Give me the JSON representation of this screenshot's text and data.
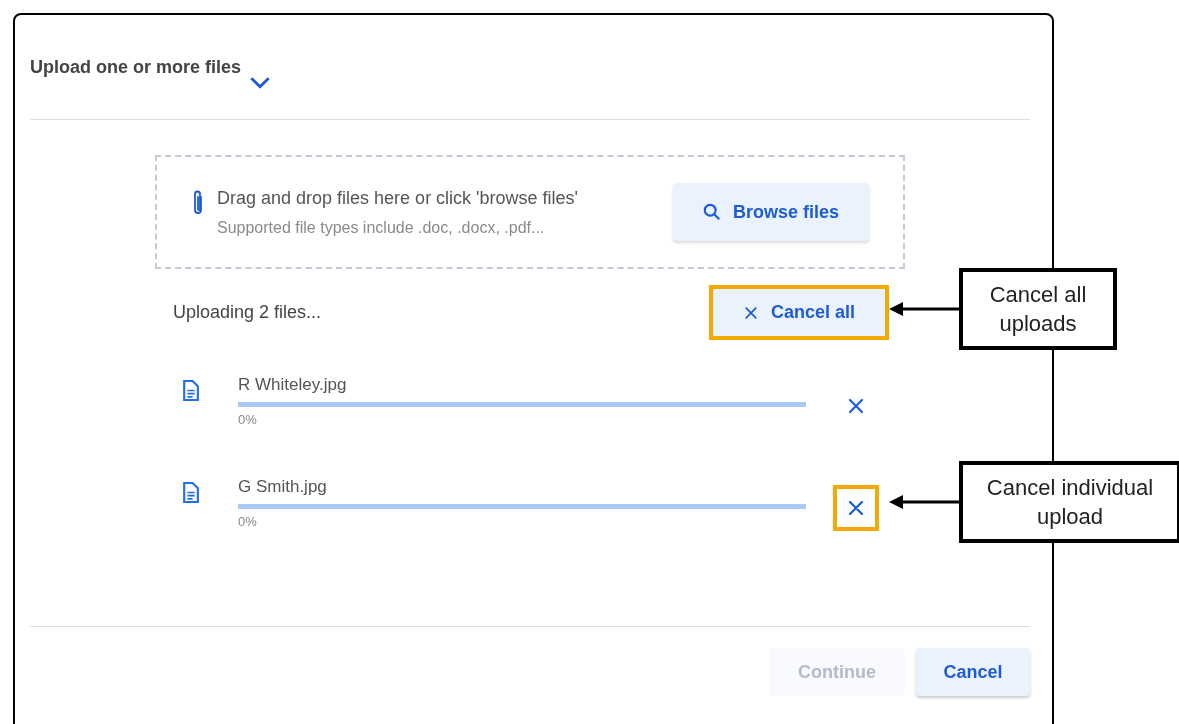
{
  "dialog": {
    "title": "Upload one or more files",
    "expanded": true
  },
  "dropzone": {
    "prompt": "Drag and drop files here or click 'browse files'",
    "hint": "Supported file types include .doc, .docx, .pdf...",
    "browse_button": "Browse files"
  },
  "upload_status": {
    "text": "Uploading 2 files...",
    "cancel_all": {
      "label": "Cancel all",
      "highlighted": true
    }
  },
  "files": [
    {
      "name": "R Whiteley.jpg",
      "level": 0,
      "reading": "0%",
      "cancel_highlighted": false
    },
    {
      "name": "G Smith.jpg",
      "level": 0,
      "reading": "0%",
      "cancel_highlighted": true
    }
  ],
  "footer": {
    "buttons": [
      {
        "label": "Continue",
        "disabled": true
      },
      {
        "label": "Cancel",
        "disabled": false
      }
    ]
  },
  "callouts": [
    {
      "text": "Cancel all uploads"
    },
    {
      "text": "Cancel individual upload"
    }
  ]
}
